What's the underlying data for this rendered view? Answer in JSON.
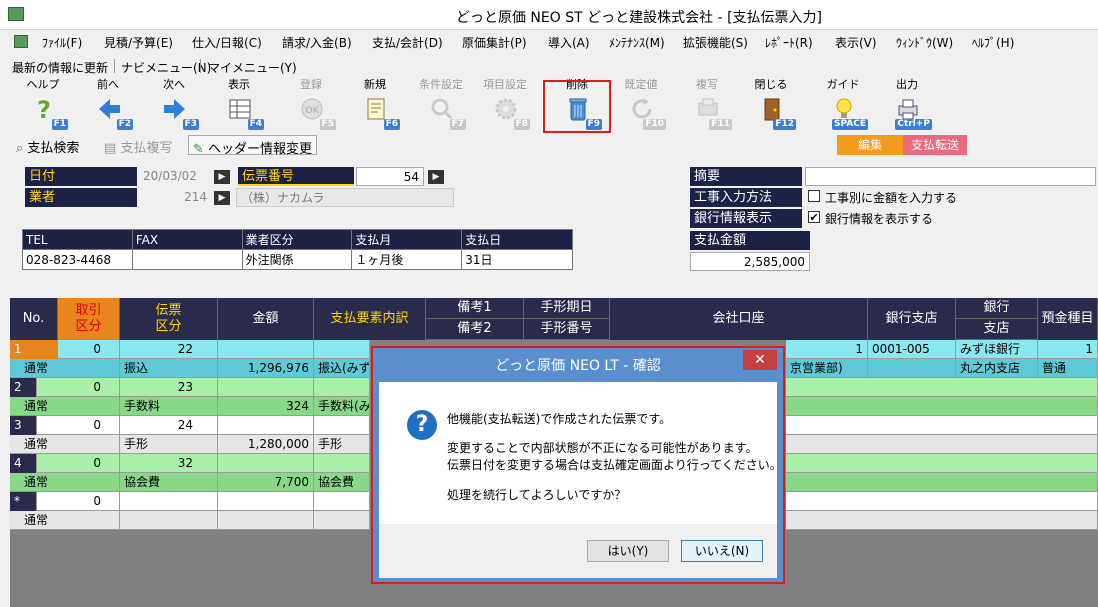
{
  "window": {
    "title": "どっと原価 NEO ST どっと建設株式会社 - [支払伝票入力]"
  },
  "menu": [
    "ﾌｧｲﾙ(F)",
    "見積/予算(E)",
    "仕入/日報(C)",
    "請求/入金(B)",
    "支払/会計(D)",
    "原価集計(P)",
    "導入(A)",
    "ﾒﾝﾃﾅﾝｽ(M)",
    "拡張機能(S)",
    "ﾚﾎﾟｰﾄ(R)",
    "表示(V)",
    "ｳｨﾝﾄﾞｳ(W)",
    "ﾍﾙﾌﾟ(H)"
  ],
  "nav": {
    "refresh": "最新の情報に更新",
    "navi": "ナビメニュー(N)",
    "my": "マイメニュー(Y)"
  },
  "toolbar": [
    {
      "label": "ヘルプ",
      "key": "F1",
      "icon": "help-icon",
      "enabled": true
    },
    {
      "label": "前へ",
      "key": "F2",
      "icon": "arrow-left-icon",
      "enabled": true
    },
    {
      "label": "次へ",
      "key": "F3",
      "icon": "arrow-right-icon",
      "enabled": true
    },
    {
      "label": "表示",
      "key": "F4",
      "icon": "table-icon",
      "enabled": true
    },
    {
      "label": "登録",
      "key": "F5",
      "icon": "ok-icon",
      "enabled": false
    },
    {
      "label": "新規",
      "key": "F6",
      "icon": "new-doc-icon",
      "enabled": true
    },
    {
      "label": "条件設定",
      "key": "F7",
      "icon": "search-icon",
      "enabled": false
    },
    {
      "label": "項目設定",
      "key": "F8",
      "icon": "gear-icon",
      "enabled": false
    },
    {
      "label": "削除",
      "key": "F9",
      "icon": "trash-icon",
      "enabled": true
    },
    {
      "label": "既定値",
      "key": "F10",
      "icon": "refresh-icon",
      "enabled": false
    },
    {
      "label": "複写",
      "key": "F11",
      "icon": "copy-icon",
      "enabled": false
    },
    {
      "label": "閉じる",
      "key": "F12",
      "icon": "door-icon",
      "enabled": true
    },
    {
      "label": "ガイド",
      "key": "SPACE",
      "icon": "bulb-icon",
      "enabled": true
    },
    {
      "label": "出力",
      "key": "Ctrl+P",
      "icon": "print-icon",
      "enabled": true
    }
  ],
  "subbar": {
    "search": "支払検索",
    "copy": "支払複写",
    "header_change": "ヘッダー情報変更",
    "edit": "編集",
    "transfer": "支払転送"
  },
  "header": {
    "date_label": "日付",
    "date_value": "20/03/02",
    "slip_label": "伝票番号",
    "slip_value": "54",
    "vendor_label": "業者",
    "vendor_code": "214",
    "vendor_name": "（株）ナカムラ",
    "summary_label": "摘要",
    "summary_value": "",
    "input_method_label": "工事入力方法",
    "input_method_option": "工事別に金額を入力する",
    "bank_label": "銀行情報表示",
    "bank_option": "銀行情報を表示する",
    "total_label": "支払金額",
    "total_value": "2,585,000"
  },
  "info_table": {
    "headers": [
      "TEL",
      "FAX",
      "業者区分",
      "支払月",
      "支払日"
    ],
    "values": [
      "028-823-4468",
      "",
      "外注関係",
      "１ヶ月後",
      "31日"
    ]
  },
  "grid": {
    "headers": {
      "no": "No.",
      "type": "取引\n区分",
      "slip_type": "伝票\n区分",
      "amount": "金額",
      "detail": "支払要素内訳",
      "note1": "備考1",
      "note2": "備考2",
      "bill_due": "手形期日",
      "bill_no": "手形番号",
      "account": "会社口座",
      "branch": "銀行支店",
      "bank": "銀行",
      "bank_branch": "支店",
      "deposit": "預金種目"
    },
    "rows": [
      {
        "no": "1",
        "type_code": "0",
        "type": "通常",
        "slip_code": "22",
        "slip": "振込",
        "amount": "1,296,976",
        "detail": "振込(みず",
        "acct_no": "1",
        "acct_name": "京営業部)",
        "branch": "0001-005",
        "bank": "みずほ銀行",
        "bank_branch": "丸之内支店",
        "dep_code": "1",
        "dep": "普通"
      },
      {
        "no": "2",
        "type_code": "0",
        "type": "通常",
        "slip_code": "23",
        "slip": "手数料",
        "amount": "324",
        "detail": "手数料(み"
      },
      {
        "no": "3",
        "type_code": "0",
        "type": "通常",
        "slip_code": "24",
        "slip": "手形",
        "amount": "1,280,000",
        "detail": "手形"
      },
      {
        "no": "4",
        "type_code": "0",
        "type": "通常",
        "slip_code": "32",
        "slip": "協会費",
        "amount": "7,700",
        "detail": "協会費"
      },
      {
        "no": "*",
        "type_code": "0",
        "type": "通常",
        "slip_code": "",
        "slip": "",
        "amount": "",
        "detail": ""
      }
    ]
  },
  "dialog": {
    "title": "どっと原価 NEO LT - 確認",
    "line1": "他機能(支払転送)で作成された伝票です。",
    "line2": "変更することで内部状態が不正になる可能性があります。",
    "line3": "伝票日付を変更する場合は支払確定画面より行ってください。",
    "line4": "処理を続行してよろしいですか？",
    "yes": "はい(Y)",
    "no": "いいえ(N)"
  }
}
